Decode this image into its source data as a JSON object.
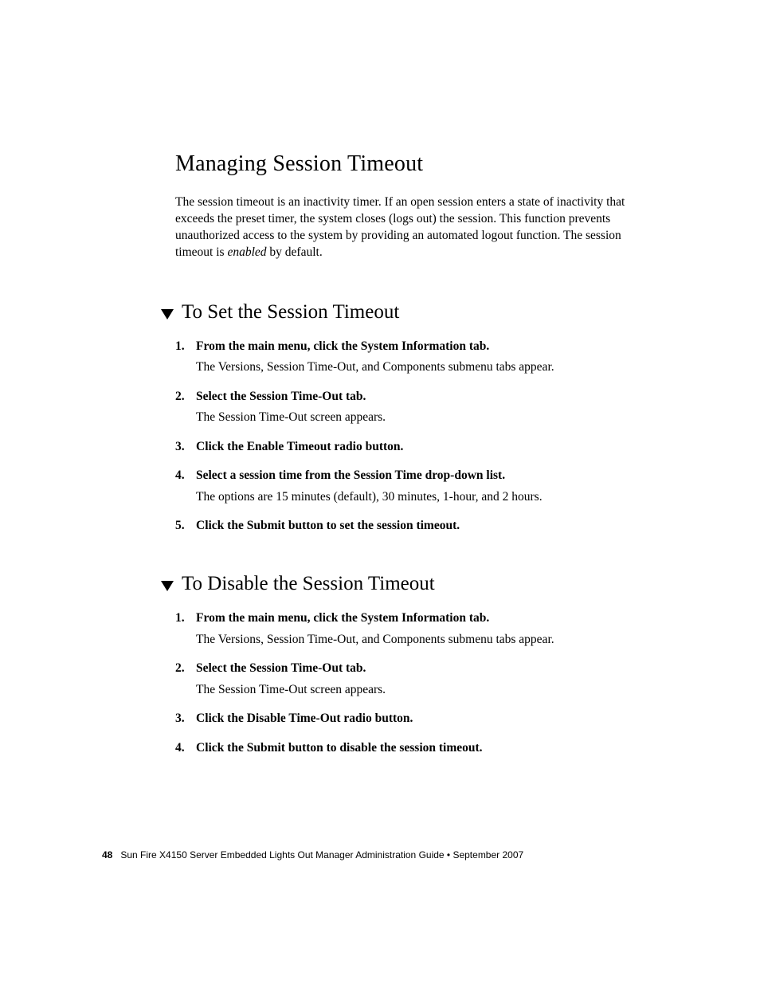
{
  "section": {
    "title": "Managing Session Timeout",
    "intro_before_em": "The session timeout is an inactivity timer. If an open session enters a state of inactivity that exceeds the preset timer, the system closes (logs out) the session. This function prevents unauthorized access to the system by providing an automated logout function. The session timeout is ",
    "intro_em": "enabled",
    "intro_after_em": " by default."
  },
  "set": {
    "title": "To Set the Session Timeout",
    "steps": [
      {
        "head": "From the main menu, click the System Information tab.",
        "body": "The Versions, Session Time-Out, and Components submenu tabs appear."
      },
      {
        "head": "Select the Session Time-Out tab.",
        "body": "The Session Time-Out screen appears."
      },
      {
        "head": "Click the Enable Timeout radio button.",
        "body": ""
      },
      {
        "head": "Select a session time from the Session Time drop-down list.",
        "body": "The options are 15 minutes (default), 30 minutes, 1-hour, and 2 hours."
      },
      {
        "head": "Click the Submit button to set the session timeout.",
        "body": ""
      }
    ]
  },
  "disable": {
    "title": "To Disable the Session Timeout",
    "steps": [
      {
        "head": "From the main menu, click the System Information tab.",
        "body": "The Versions, Session Time-Out, and Components submenu tabs appear."
      },
      {
        "head": "Select the Session Time-Out tab.",
        "body": "The Session Time-Out screen appears."
      },
      {
        "head": "Click the Disable Time-Out radio button.",
        "body": ""
      },
      {
        "head": "Click the Submit button to disable the session timeout.",
        "body": ""
      }
    ]
  },
  "footer": {
    "page": "48",
    "text": "Sun Fire X4150 Server Embedded Lights Out Manager Administration Guide  •  September 2007"
  }
}
